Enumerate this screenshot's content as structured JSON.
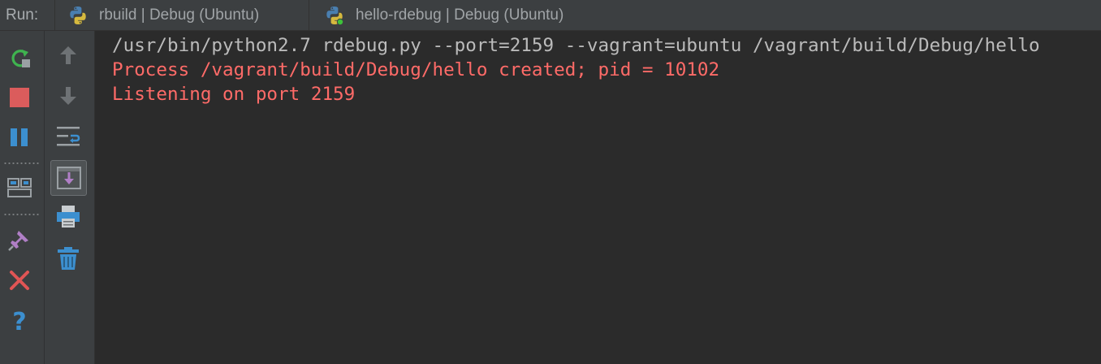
{
  "run_panel": {
    "label": "Run:",
    "tabs": [
      {
        "label": "rbuild | Debug (Ubuntu)",
        "icon": "python-icon",
        "active": false
      },
      {
        "label": "hello-rdebug | Debug (Ubuntu)",
        "icon": "python-running-icon",
        "active": true
      }
    ]
  },
  "toolbar_primary": [
    {
      "icon": "rerun-icon"
    },
    {
      "icon": "stop-icon"
    },
    {
      "icon": "pause-icon"
    },
    {
      "icon": "restore-layout-icon"
    },
    {
      "icon": "pin-tab-icon"
    },
    {
      "icon": "close-icon"
    },
    {
      "icon": "help-icon"
    }
  ],
  "toolbar_secondary": [
    {
      "icon": "up-arrow-icon"
    },
    {
      "icon": "down-arrow-icon"
    },
    {
      "icon": "soft-wrap-icon"
    },
    {
      "icon": "scroll-to-end-icon"
    },
    {
      "icon": "print-icon"
    },
    {
      "icon": "trash-icon"
    }
  ],
  "console": {
    "lines": [
      {
        "text": "/usr/bin/python2.7 rdebug.py --port=2159 --vagrant=ubuntu /vagrant/build/Debug/hello",
        "kind": "command"
      },
      {
        "text": "Process /vagrant/build/Debug/hello created; pid = 10102",
        "kind": "stderr"
      },
      {
        "text": "Listening on port 2159",
        "kind": "stderr"
      }
    ]
  },
  "colors": {
    "background": "#2b2b2b",
    "panel": "#3c3f41",
    "command_text": "#bbbbbb",
    "error_text": "#ff6b68"
  }
}
